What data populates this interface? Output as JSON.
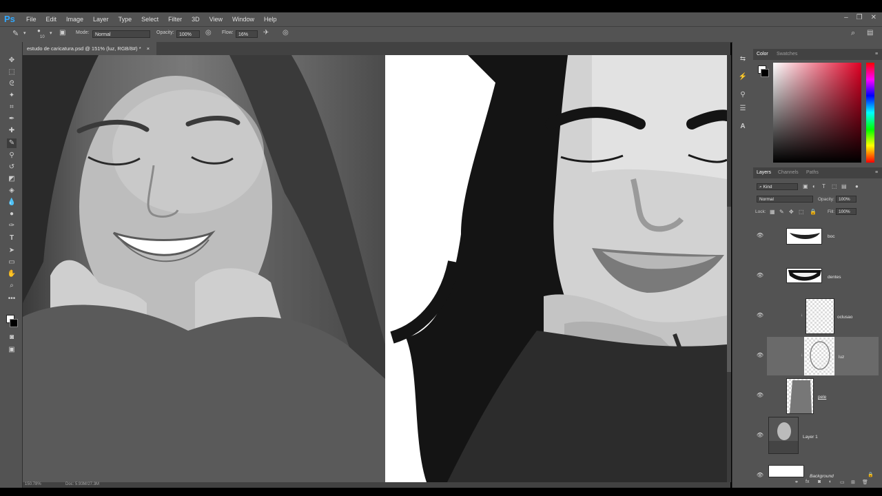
{
  "app": {
    "logo": "Ps"
  },
  "menu": [
    "File",
    "Edit",
    "Image",
    "Layer",
    "Type",
    "Select",
    "Filter",
    "3D",
    "View",
    "Window",
    "Help"
  ],
  "window_controls": [
    "–",
    "❐",
    "✕"
  ],
  "options_bar": {
    "brush_size": "10",
    "mode_label": "Mode:",
    "mode_value": "Normal",
    "opacity_label": "Opacity:",
    "opacity_value": "100%",
    "flow_label": "Flow:",
    "flow_value": "16%"
  },
  "document": {
    "tab_title": "estudo de caricatura.psd @ 151% (luz, RGB/8#) *",
    "tab_close": "×",
    "status_zoom": "150.78%",
    "status_doc": "Doc: 5.93M/27.3M"
  },
  "color_panel": {
    "tabs": [
      "Color",
      "Swatches"
    ],
    "active": "Color",
    "accent": "#e00024"
  },
  "layers_panel": {
    "tabs": [
      "Layers",
      "Channels",
      "Paths"
    ],
    "active": "Layers",
    "kind_filter": "Kind",
    "blend_mode": "Normal",
    "opacity_label": "Opacity:",
    "opacity_value": "100%",
    "lock_label": "Lock:",
    "fill_label": "Fill:",
    "fill_value": "100%",
    "layers": [
      {
        "name": "boc",
        "active": false
      },
      {
        "name": "dentes",
        "active": false
      },
      {
        "name": "oclusao",
        "active": false
      },
      {
        "name": "luz",
        "active": true
      },
      {
        "name": "pele",
        "active": false
      },
      {
        "name": "Layer 1",
        "active": false
      },
      {
        "name": "Background",
        "active": false
      }
    ]
  }
}
